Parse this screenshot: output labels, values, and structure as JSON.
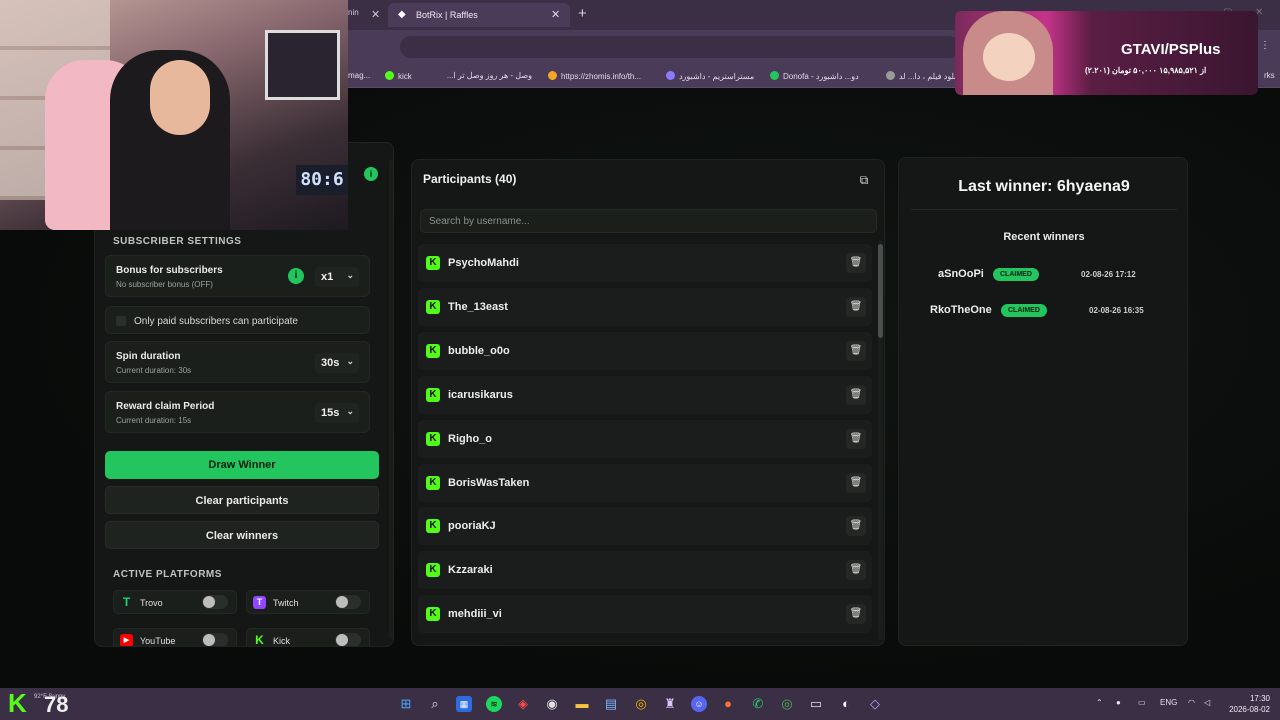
{
  "browser": {
    "partial_tab_title": "nin",
    "active_tab": {
      "title": "BotRix | Raffles"
    },
    "new_tab_icon": "plus-icon",
    "window_controls": [
      "minimize-icon",
      "maximize-icon",
      "close-icon"
    ],
    "bookmarks": [
      {
        "label": "mag...",
        "color": "#7c5cff"
      },
      {
        "label": "kick",
        "color": "#53fc18"
      },
      {
        "label": "وصل - هر روز وصل تر ا...",
        "color": "#8a8a8a"
      },
      {
        "label": "https://zhomis.info/th...",
        "color": "#f5a623"
      },
      {
        "label": "مستراستریم - داشبورد",
        "color": "#8a7cff"
      },
      {
        "label": "Donofa - دو... داشبورد",
        "color": "#22c55e"
      },
      {
        "label": "دانلود فیلم ، دا... لد",
        "color": "#9a9a9a"
      },
      {
        "label": "rks",
        "color": "#9a9a9a"
      }
    ]
  },
  "webcam": {
    "clock_text": "80:6"
  },
  "ad": {
    "title": "GTAVI/PSPlus",
    "subtitle": "از ۱۵,۹۸۵,۵۲۱ ۵۰,۰۰۰ تومان (۲.۲۰۱)"
  },
  "left_panel": {
    "info_icon": "info-icon",
    "subscriber_settings": {
      "title": "SUBSCRIBER SETTINGS",
      "bonus": {
        "label": "Bonus for subscribers",
        "sub": "No subscriber bonus (OFF)",
        "value": "x1"
      },
      "paid_only_label": "Only paid subscribers can participate",
      "spin": {
        "label": "Spin duration",
        "sub": "Current duration: 30s",
        "value": "30s"
      },
      "claim": {
        "label": "Reward claim Period",
        "sub": "Current duration: 15s",
        "value": "15s"
      }
    },
    "buttons": {
      "draw": "Draw Winner",
      "clear_participants": "Clear participants",
      "clear_winners": "Clear winners"
    },
    "active_platforms": {
      "title": "ACTIVE PLATFORMS",
      "items": [
        {
          "name": "Trovo",
          "color": "#19d66b",
          "glyph": "T"
        },
        {
          "name": "Twitch",
          "color": "#9146ff",
          "glyph": "T"
        },
        {
          "name": "YouTube",
          "color": "#ff0000",
          "glyph": "▶"
        },
        {
          "name": "Kick",
          "color": "#53fc18",
          "glyph": "K"
        }
      ]
    }
  },
  "participants": {
    "title": "Participants (40)",
    "search_placeholder": "Search by username...",
    "platform_color": "#53fc18",
    "list": [
      "PsychoMahdi",
      "The_13east",
      "bubble_o0o",
      "icarusikarus",
      "Righo_o",
      "BorisWasTaken",
      "pooriaKJ",
      "Kzzaraki",
      "mehdiii_vi"
    ]
  },
  "winners": {
    "last_winner": "Last winner: 6hyaena9",
    "recent_title": "Recent winners",
    "list": [
      {
        "name": "aSnOoPi",
        "status": "CLAIMED",
        "time": "02-08-26 17:12"
      },
      {
        "name": "RkoTheOne",
        "status": "CLAIMED",
        "time": "02-08-26 16:35"
      }
    ]
  },
  "taskbar": {
    "weather_temp": "78",
    "weather_desc": "92°F Sunny",
    "icons": [
      "windows-start-icon",
      "search-icon",
      "widget-icon",
      "spotify-icon",
      "app-icon",
      "steam-icon",
      "file-explorer-icon",
      "store-icon",
      "chrome-icon",
      "app-icon-2",
      "discord-icon",
      "firefox-icon",
      "whatsapp-icon",
      "chrome-icon-2",
      "terminal-icon",
      "obs-icon",
      "app-icon-3"
    ],
    "language": "ENG",
    "time": "17:30",
    "date": "2026-08-02"
  }
}
